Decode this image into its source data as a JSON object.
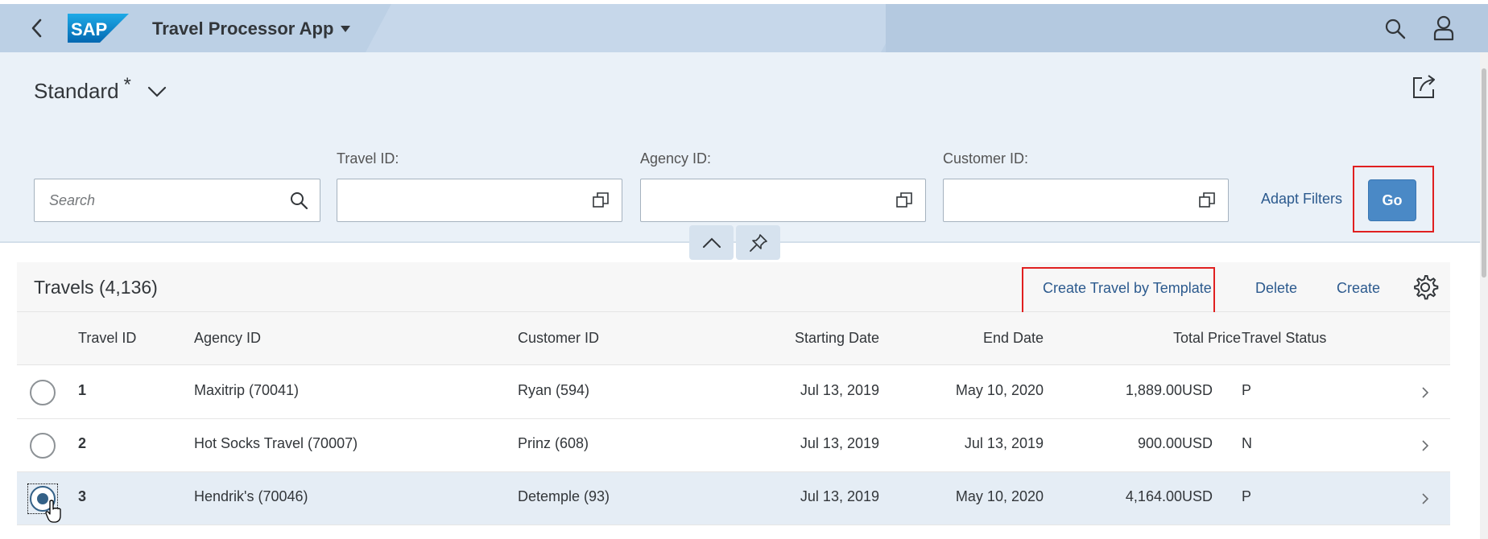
{
  "shell": {
    "logo_text": "SAP",
    "app_title": "Travel Processor App",
    "icons": [
      "back-icon",
      "caret-down-icon",
      "search-icon",
      "user-icon"
    ]
  },
  "header": {
    "variant_name": "Standard",
    "variant_modified": "*",
    "share_icon": "share-icon"
  },
  "filters": {
    "search_placeholder": "Search",
    "travel_id_label": "Travel ID:",
    "agency_id_label": "Agency ID:",
    "customer_id_label": "Customer ID:",
    "value_help_icon": "value-help-icon",
    "adapt_filters_label": "Adapt Filters",
    "go_label": "Go"
  },
  "table": {
    "title": "Travels (4,136)",
    "toolbar": {
      "create_by_template": "Create Travel by Template",
      "delete": "Delete",
      "create": "Create",
      "settings_icon": "gear-icon"
    },
    "columns": [
      "Travel ID",
      "Agency ID",
      "Customer ID",
      "Starting Date",
      "End Date",
      "Total Price",
      "Travel Status"
    ],
    "rows": [
      {
        "travel_id": "1",
        "agency": "Maxitrip (70041)",
        "customer": "Ryan (594)",
        "start": "Jul 13, 2019",
        "end": "May 10, 2020",
        "price": "1,889.00",
        "currency": "USD",
        "status": "P",
        "selected": false
      },
      {
        "travel_id": "2",
        "agency": "Hot Socks Travel (70007)",
        "customer": "Prinz (608)",
        "start": "Jul 13, 2019",
        "end": "Jul 13, 2019",
        "price": "900.00",
        "currency": "USD",
        "status": "N",
        "selected": false
      },
      {
        "travel_id": "3",
        "agency": "Hendrik's (70046)",
        "customer": "Detemple (93)",
        "start": "Jul 13, 2019",
        "end": "May 10, 2020",
        "price": "4,164.00",
        "currency": "USD",
        "status": "P",
        "selected": true
      }
    ]
  },
  "colors": {
    "shell_bg": "#bcd0e5",
    "header_bg": "#eaf1f8",
    "accent": "#4a89c6",
    "link": "#2c5a8e",
    "highlight": "#e02020",
    "selected_row": "#e5edf5"
  }
}
